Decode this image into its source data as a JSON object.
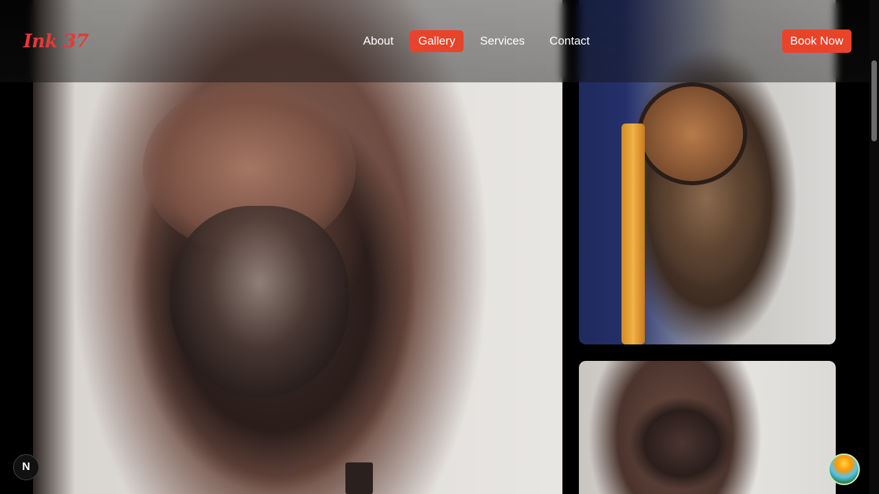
{
  "brand": {
    "logo_text": "Ink 37",
    "accent_color": "#e8442a",
    "logo_color": "#e53935"
  },
  "nav": {
    "items": [
      {
        "label": "About",
        "active": false
      },
      {
        "label": "Gallery",
        "active": true
      },
      {
        "label": "Services",
        "active": false
      },
      {
        "label": "Contact",
        "active": false
      }
    ]
  },
  "header": {
    "cta_label": "Book Now"
  },
  "gallery": {
    "images": [
      {
        "subject": "jesus-portrait-tattoo"
      },
      {
        "subject": "lion-clock-sleeve-tattoo"
      },
      {
        "subject": "rose-tattoo"
      }
    ]
  },
  "floating": {
    "dev_badge_label": "N",
    "chat_icon": "beach-orb-icon"
  }
}
